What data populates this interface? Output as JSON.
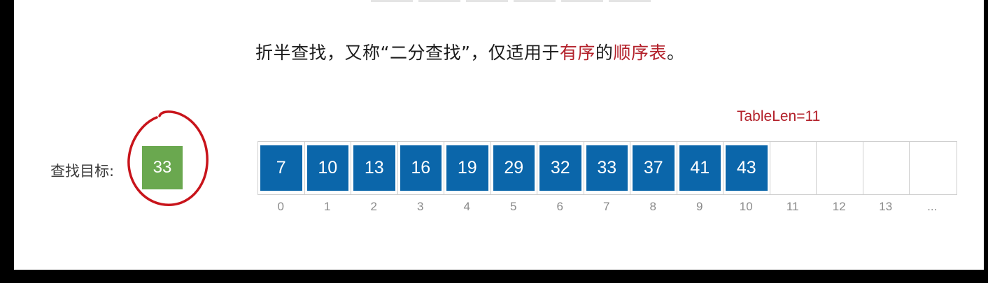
{
  "headline": {
    "part1": "折半查找，又称“二分查找”，仅适用于",
    "accent1": "有序",
    "part2": "的",
    "accent2": "顺序表",
    "part3": "。"
  },
  "table_len_label": "TableLen=11",
  "target": {
    "label": "查找目标:",
    "value": "33"
  },
  "array": {
    "values": [
      "7",
      "10",
      "13",
      "16",
      "19",
      "29",
      "32",
      "33",
      "37",
      "41",
      "43",
      "",
      "",
      "",
      ""
    ],
    "indices": [
      "0",
      "1",
      "2",
      "3",
      "4",
      "5",
      "6",
      "7",
      "8",
      "9",
      "10",
      "11",
      "12",
      "13",
      "..."
    ]
  },
  "colors": {
    "filled_cell": "#0b66aa",
    "target_cell": "#6aa84f",
    "accent_text": "#b3202a",
    "annotation_circle": "#c8141b"
  }
}
